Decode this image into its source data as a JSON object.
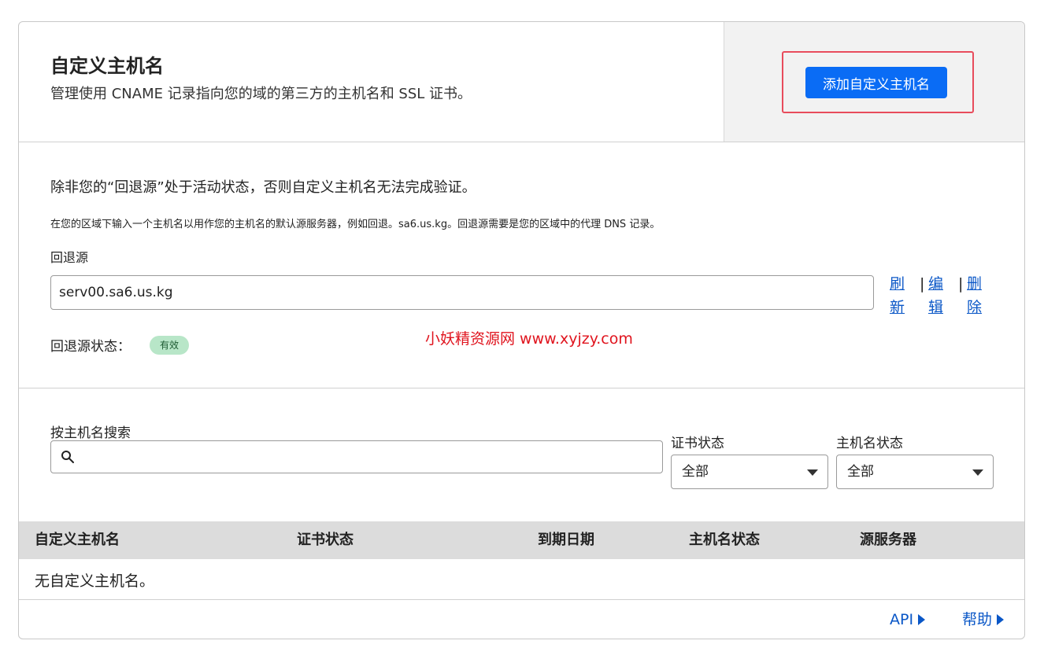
{
  "header": {
    "title": "自定义主机名",
    "subtitle": "管理使用 CNAME 记录指向您的域的第三方的主机名和 SSL 证书。",
    "add_button": "添加自定义主机名"
  },
  "fallback": {
    "heading": "除非您的“回退源”处于活动状态，否则自定义主机名无法完成验证。",
    "description": "在您的区域下输入一个主机名以用作您的主机名的默认源服务器，例如回退。sa6.us.kg。回退源需要是您的区域中的代理 DNS 记录。",
    "label": "回退源",
    "input_value": "serv00.sa6.us.kg",
    "actions": {
      "refresh": "刷新",
      "edit": "编辑",
      "delete": "删除",
      "separator": "|"
    },
    "status_label": "回退源状态：",
    "status_badge": "有效"
  },
  "watermark": "小妖精资源网 www.xyjzy.com",
  "filters": {
    "search_label": "按主机名搜索",
    "search_value": "",
    "cert_status_label": "证书状态",
    "cert_status_value": "全部",
    "hostname_status_label": "主机名状态",
    "hostname_status_value": "全部"
  },
  "table": {
    "columns": [
      "自定义主机名",
      "证书状态",
      "到期日期",
      "主机名状态",
      "源服务器"
    ],
    "empty_message": "无自定义主机名。"
  },
  "footer": {
    "api_link": "API",
    "help_link": "帮助"
  },
  "colors": {
    "primary": "#0a6cf5",
    "link": "#0a57c7",
    "highlight": "#e84c5c",
    "badge_bg": "#b8e6c8",
    "watermark": "#e0141e"
  }
}
